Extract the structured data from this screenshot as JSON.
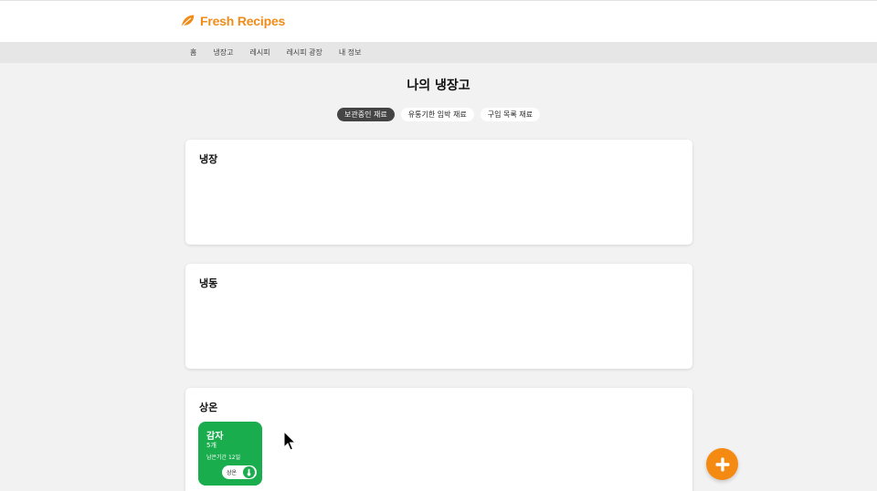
{
  "app": {
    "title": "Fresh Recipes",
    "logo_icon": "leaf-icon",
    "brand_color": "#f08c1a"
  },
  "nav": {
    "items": [
      {
        "label": "홈"
      },
      {
        "label": "냉장고"
      },
      {
        "label": "레시피"
      },
      {
        "label": "레시피 광장"
      },
      {
        "label": "내 정보"
      }
    ]
  },
  "page": {
    "title": "나의 냉장고"
  },
  "filters": [
    {
      "label": "보관중인 재료",
      "active": true
    },
    {
      "label": "유통기한 임박 재료",
      "active": false
    },
    {
      "label": "구입 목록 재료",
      "active": false
    }
  ],
  "sections": {
    "fridge": {
      "title": "냉장"
    },
    "freezer": {
      "title": "냉동"
    },
    "room": {
      "title": "상온",
      "items": [
        {
          "name": "감자",
          "quantity": "5개",
          "days_left": "남은기간 12일",
          "storage": "상온",
          "storage_icon": "thermometer-icon",
          "color": "#19ad4d"
        }
      ]
    }
  },
  "fab": {
    "icon": "plus-icon",
    "color": "#f58a12"
  }
}
